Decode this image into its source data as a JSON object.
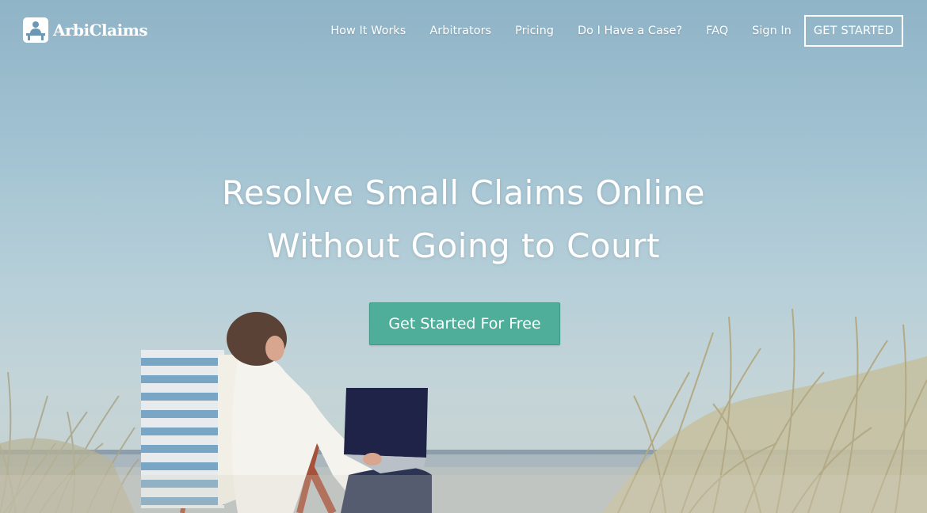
{
  "brand": {
    "name": "ArbiClaims",
    "logo_icon": "person-at-desk-icon"
  },
  "nav": {
    "items": [
      "How It Works",
      "Arbitrators",
      "Pricing",
      "Do I Have a Case?",
      "FAQ",
      "Sign In"
    ],
    "cta": "GET STARTED"
  },
  "hero": {
    "headline_line1": "Resolve Small Claims Online",
    "headline_line2": "Without Going to Court",
    "button": "Get Started For Free",
    "button_color": "#4eae99"
  }
}
